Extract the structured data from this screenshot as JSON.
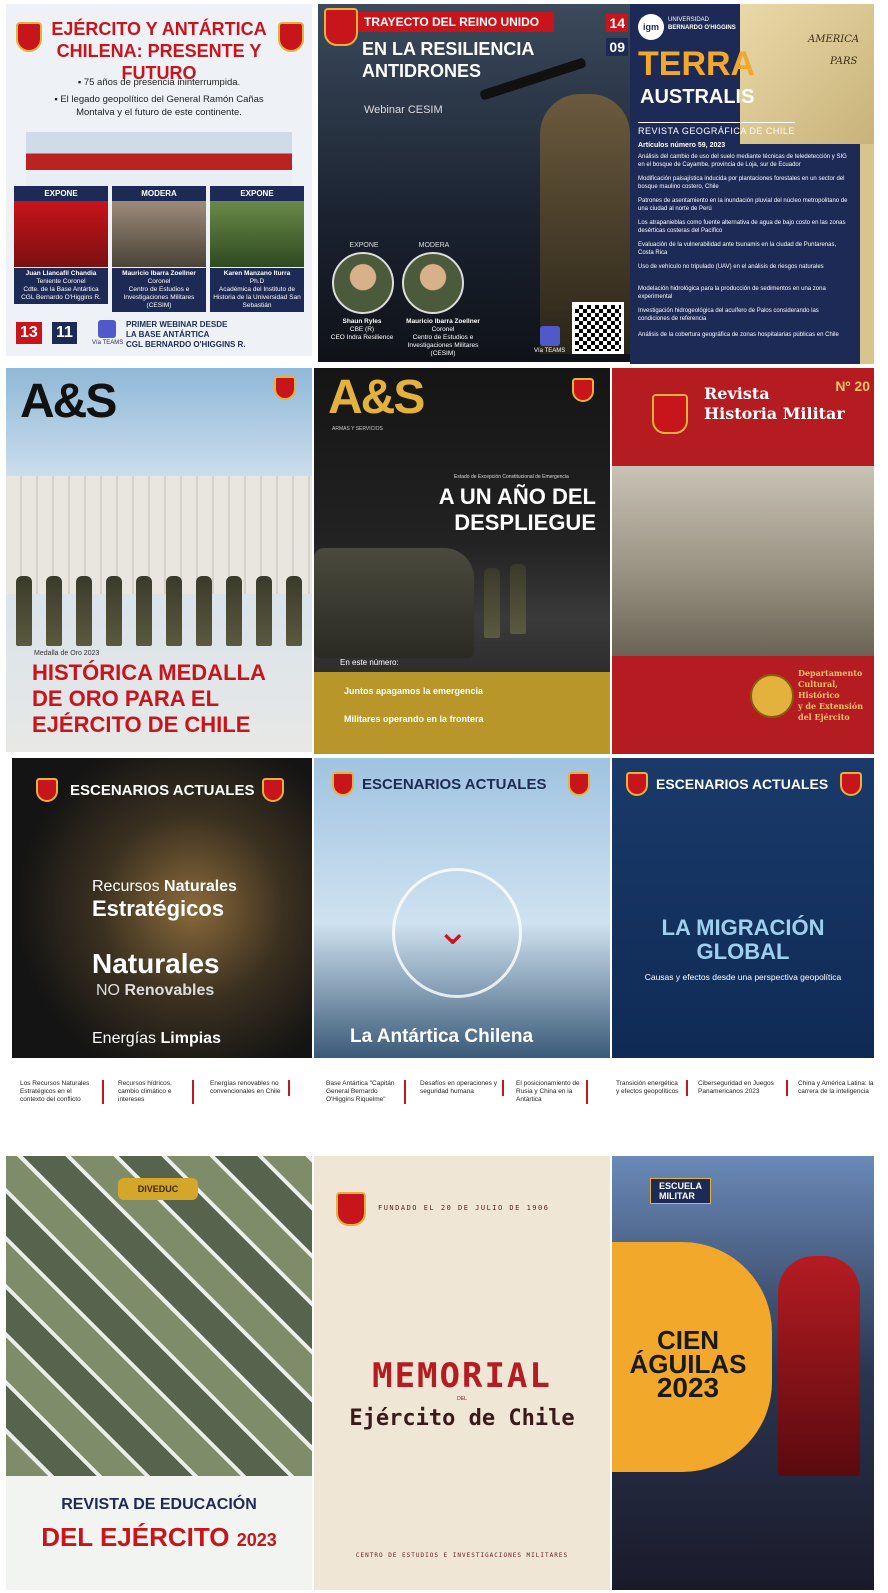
{
  "row1": {
    "tile1": {
      "title_line1": "EJÉRCITO Y ANTÁRTICA",
      "title_line2": "CHILENA: PRESENTE Y FUTURO",
      "bullet1": "75 años de presencia ininterrumpida.",
      "bullet2a": "El legado geopolítico del General Ramón Cañas",
      "bullet2b": "Montalva y el futuro de este continente.",
      "col1_header": "EXPONE",
      "col2_header": "MODERA",
      "col3_header": "EXPONE",
      "p1_name": "Juan Llancafil Chandia",
      "p1_role": "Teniente Coronel",
      "p1_detail": "Cdte. de la Base Antártica CGL Bernardo O'Higgins R.",
      "p2_name": "Mauricio Ibarra Zoellner",
      "p2_role": "Coronel",
      "p2_detail": "Centro de Estudios e Investigaciones Militares (CESIM)",
      "p3_name": "Karen Manzano Iturra",
      "p3_role": "Ph.D",
      "p3_detail": "Académica del Instituto de Historia de la Universidad San Sebastián",
      "date_day": "13",
      "date_time": "11",
      "teams_label": "Vía TEAMS",
      "footer1": "PRIMER WEBINAR DESDE",
      "footer2": "LA BASE ANTÁRTICA",
      "footer3": "CGL BERNARDO O'HIGGINS R."
    },
    "tile2": {
      "ribbon": "TRAYECTO DEL REINO UNIDO",
      "date_day": "14",
      "date_time": "09",
      "title_line1": "EN LA RESILIENCIA",
      "title_line2": "ANTIDRONES",
      "subtitle": "Webinar CESIM",
      "expone": "EXPONE",
      "modera": "MODERA",
      "p1_name": "Shaun Ryles",
      "p1_role": "CBE (R)",
      "p1_detail": "CEO Indra Resilience",
      "p2_name": "Mauricio Ibarra Zoellner",
      "p2_role": "Coronel",
      "p2_detail": "Centro de Estudios e Investigaciones Militares (CESIM)",
      "teams_label": "Vía TEAMS"
    },
    "tile3": {
      "logo": "igm",
      "university_top": "UNIVERSIDAD",
      "university_name": "BERNARDO O'HIGGINS",
      "title_line1": "TERRA",
      "title_line2": "AUSTRALIS",
      "subtitle": "REVISTA GEOGRÁFICA DE CHILE",
      "issue": "Artículos número 59, 2023",
      "map_label1": "AMERICA",
      "map_label2": "PARS",
      "articles": [
        "Análisis del cambio de uso del suelo mediante técnicas de teledetección y SIG en el bosque de Cayambe, provincia de Loja, sur de Ecuador",
        "Modificación paisajística inducida por plantaciones forestales en un sector del bosque maulino costero, Chile",
        "Patrones de asentamiento en la inundación pluvial del núcleo metropolitano de una ciudad al norte de Perú",
        "Los atrapanieblas como fuente alternativa de agua de bajo costo en las zonas desérticas costeras del Pacífico",
        "Evaluación de la vulnerabilidad ante tsunamis en la ciudad de Puntarenas, Costa Rica",
        "Uso de vehículo no tripulado (UAV) en el análisis de riesgos naturales",
        "Modelación hidrológica para la producción de sedimentos en una zona experimental",
        "Investigación hidrogeológica del acuífero de Palos considerando las condiciones de referencia",
        "Análisis de la cobertura geográfica de zonas hospitalarias públicas en Chile"
      ]
    }
  },
  "row2": {
    "tile1": {
      "logo": "A&S",
      "kicker": "Medalla de Oro 2023",
      "headline1": "HISTÓRICA MEDALLA",
      "headline2": "DE ORO PARA EL",
      "headline3": "EJÉRCITO DE CHILE"
    },
    "tile2": {
      "logo": "A&S",
      "logo_sub": "ARMAS Y SERVICIOS",
      "kicker": "Estado de Excepción Constitucional de Emergencia",
      "headline1": "A UN AÑO DEL",
      "headline2": "DESPLIEGUE",
      "in_this_issue": "En este número:",
      "item1": "Juntos apagamos la emergencia",
      "item2": "Militares operando en la frontera"
    },
    "tile3": {
      "title1": "Revista",
      "title2": "Historia Militar",
      "issue": "Nº 20",
      "dept1": "Departamento",
      "dept2": "Cultural, Histórico",
      "dept3": "y de Extensión del Ejército"
    }
  },
  "row3": {
    "tile1": {
      "header": "ESCENARIOS ACTUALES",
      "line1a": "Recursos",
      "line1b": "Naturales",
      "line2": "Estratégicos",
      "line3": "Naturales",
      "line4a": "NO",
      "line4b": "Renovables",
      "line5a": "Energías",
      "line5b": "Limpias"
    },
    "tile2": {
      "header": "ESCENARIOS ACTUALES",
      "footer": "La Antártica Chilena"
    },
    "tile3": {
      "header": "ESCENARIOS ACTUALES",
      "title1": "LA MIGRACIÓN",
      "title2": "GLOBAL",
      "subtitle": "Causas y efectos desde una perspectiva geopolítica"
    },
    "strip": [
      "Los Recursos Naturales Estratégicos en el contexto del conflicto",
      "Recursos hídricos, cambio climático e intereses",
      "Energías renovables no convencionales en Chile",
      "Base Antártica \"Capitán General Bernardo O'Higgins Riquelme\"",
      "Desafíos en operaciones y seguridad humana",
      "El posicionamiento de Rusia y China en la Antártica",
      "Transición energética y efectos geopolíticos",
      "Ciberseguridad en Juegos Panamericanos 2023",
      "China y América Latina: la carrera de la inteligencia"
    ]
  },
  "row4": {
    "tile1": {
      "title1": "REVISTA DE EDUCACIÓN",
      "title2a": "DEL",
      "title2b": "EJÉRCITO",
      "title2c": "2023",
      "badge": "DIVEDUC"
    },
    "tile2": {
      "top": "FUNDADO EL 20 DE JULIO DE 1906",
      "title1": "MEMORIAL",
      "title_del": "DEL",
      "title2": "Ejército de Chile",
      "footer": "CENTRO DE ESTUDIOS E INVESTIGACIONES MILITARES"
    },
    "tile3": {
      "badge1": "ESCUELA",
      "badge2": "MILITAR",
      "title1": "CIEN",
      "title2": "ÁGUILAS",
      "title3": "2023"
    }
  },
  "colors": {
    "brand_red": "#c8141b",
    "navy": "#1d2a55",
    "gold": "#e3b23c",
    "orange": "#f2a82b"
  }
}
